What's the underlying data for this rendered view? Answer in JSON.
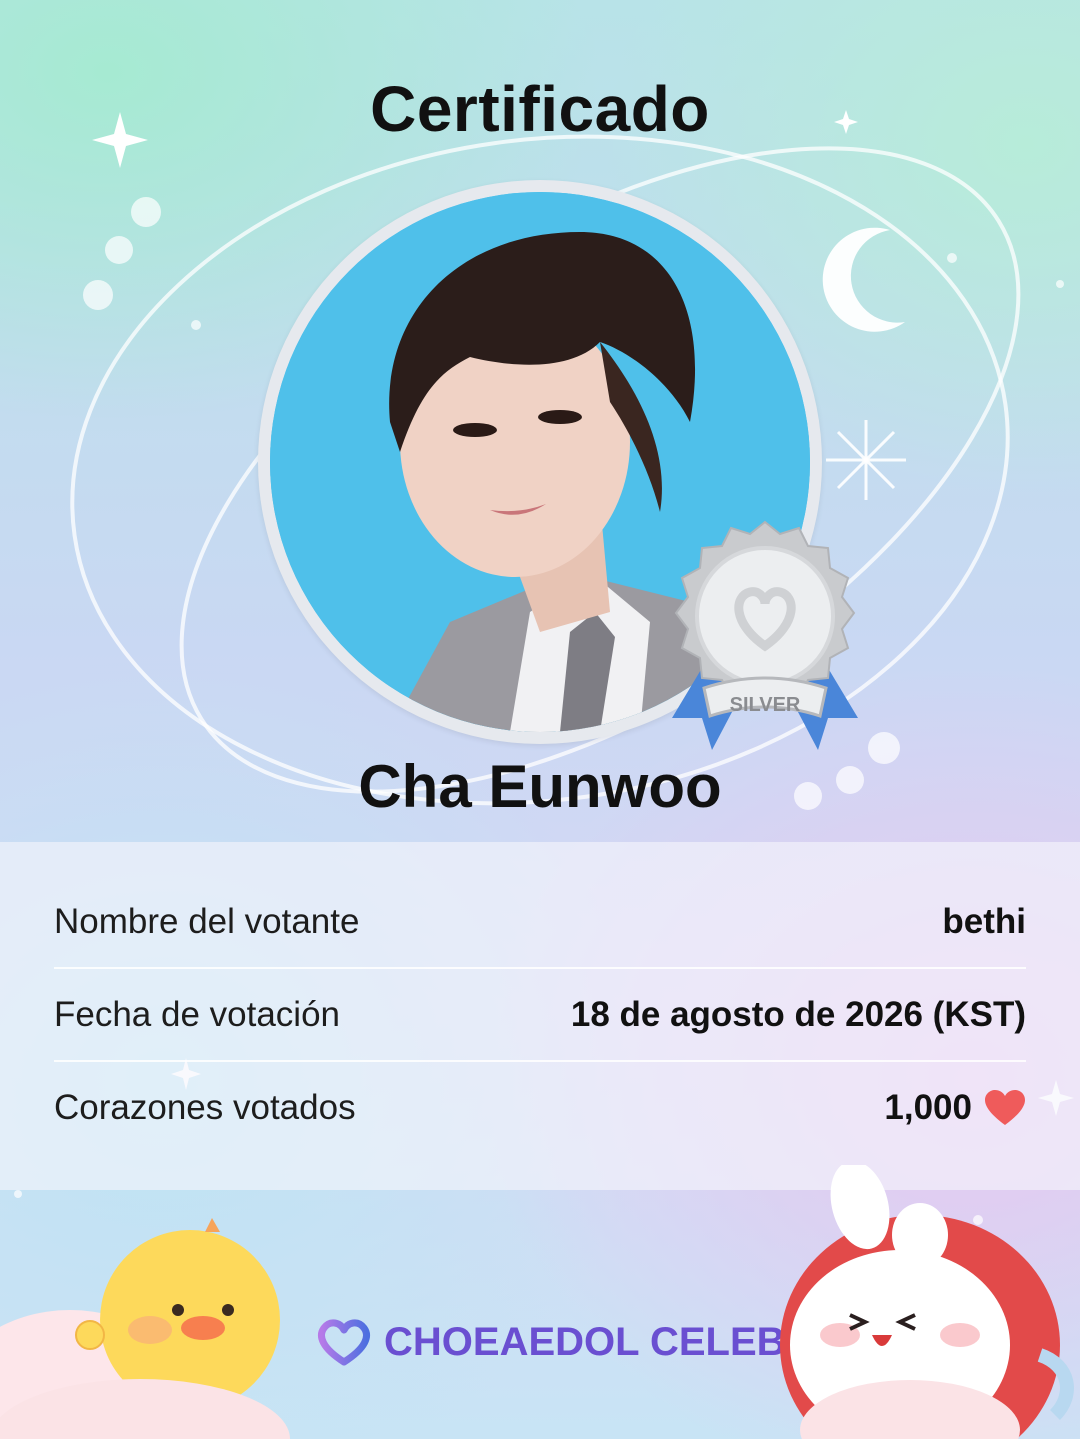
{
  "certificate": {
    "title": "Certificado",
    "celeb_name": "Cha Eunwoo",
    "badge_label": "SILVER"
  },
  "details": {
    "rows": [
      {
        "label": "Nombre del votante",
        "value": "bethi"
      },
      {
        "label": "Fecha de votación",
        "value": "18 de agosto de 2026 (KST)"
      },
      {
        "label": "Corazones votados",
        "value": "1,000",
        "icon": "heart-icon"
      }
    ]
  },
  "footer": {
    "brand": "CHOEAEDOL CELEB",
    "brand_icon": "choeaedol-logo-icon"
  },
  "colors": {
    "heart": "#ef5b5b",
    "brand": "#6a4fd1",
    "badge_ribbon": "#4a86d9"
  }
}
